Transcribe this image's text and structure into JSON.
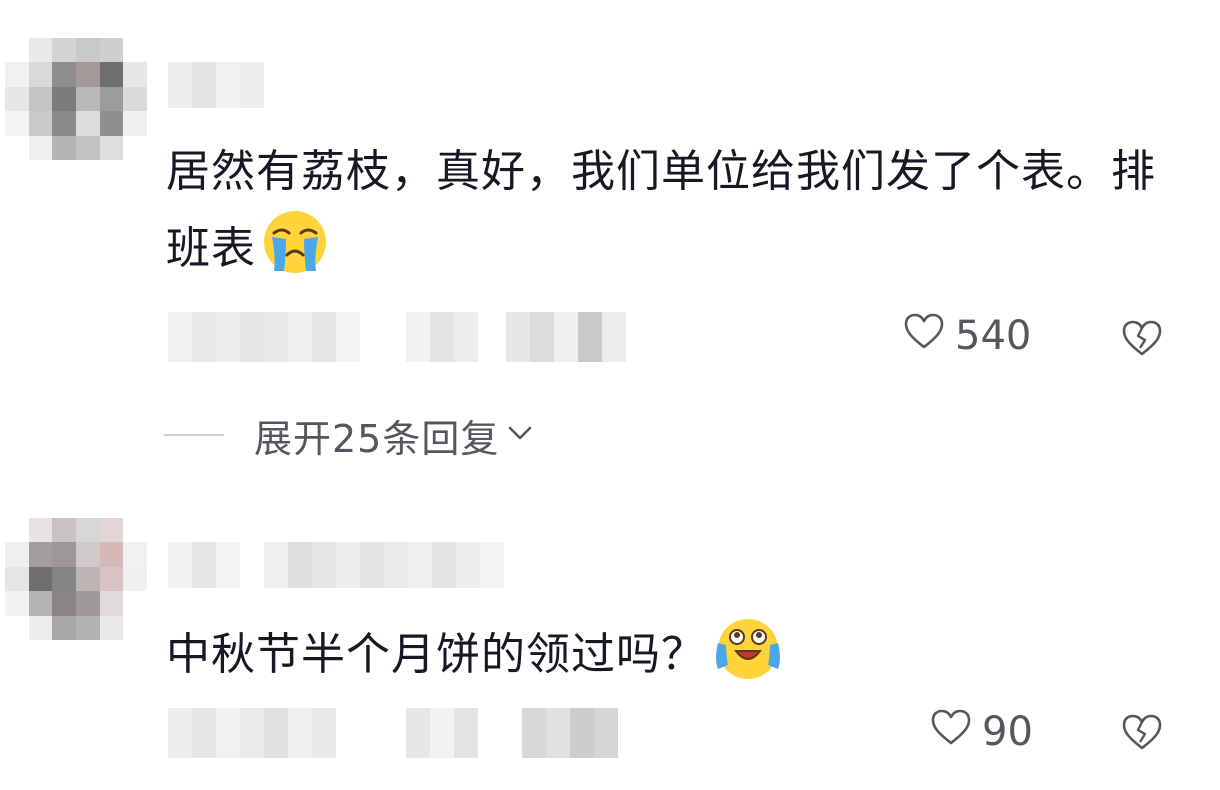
{
  "comments": [
    {
      "text": "居然有荔枝，真好，我们单位给我们发了个表。排班表",
      "emoji": "crying-face",
      "likes": "540"
    },
    {
      "text": "中秋节半个月饼的领过吗？",
      "emoji": "tearful-laughing-face",
      "likes": "90"
    }
  ],
  "expand_replies": "展开25条回复",
  "colors": {
    "text": "#161823",
    "secondary": "#55575e",
    "divider": "#d0d1d4"
  }
}
